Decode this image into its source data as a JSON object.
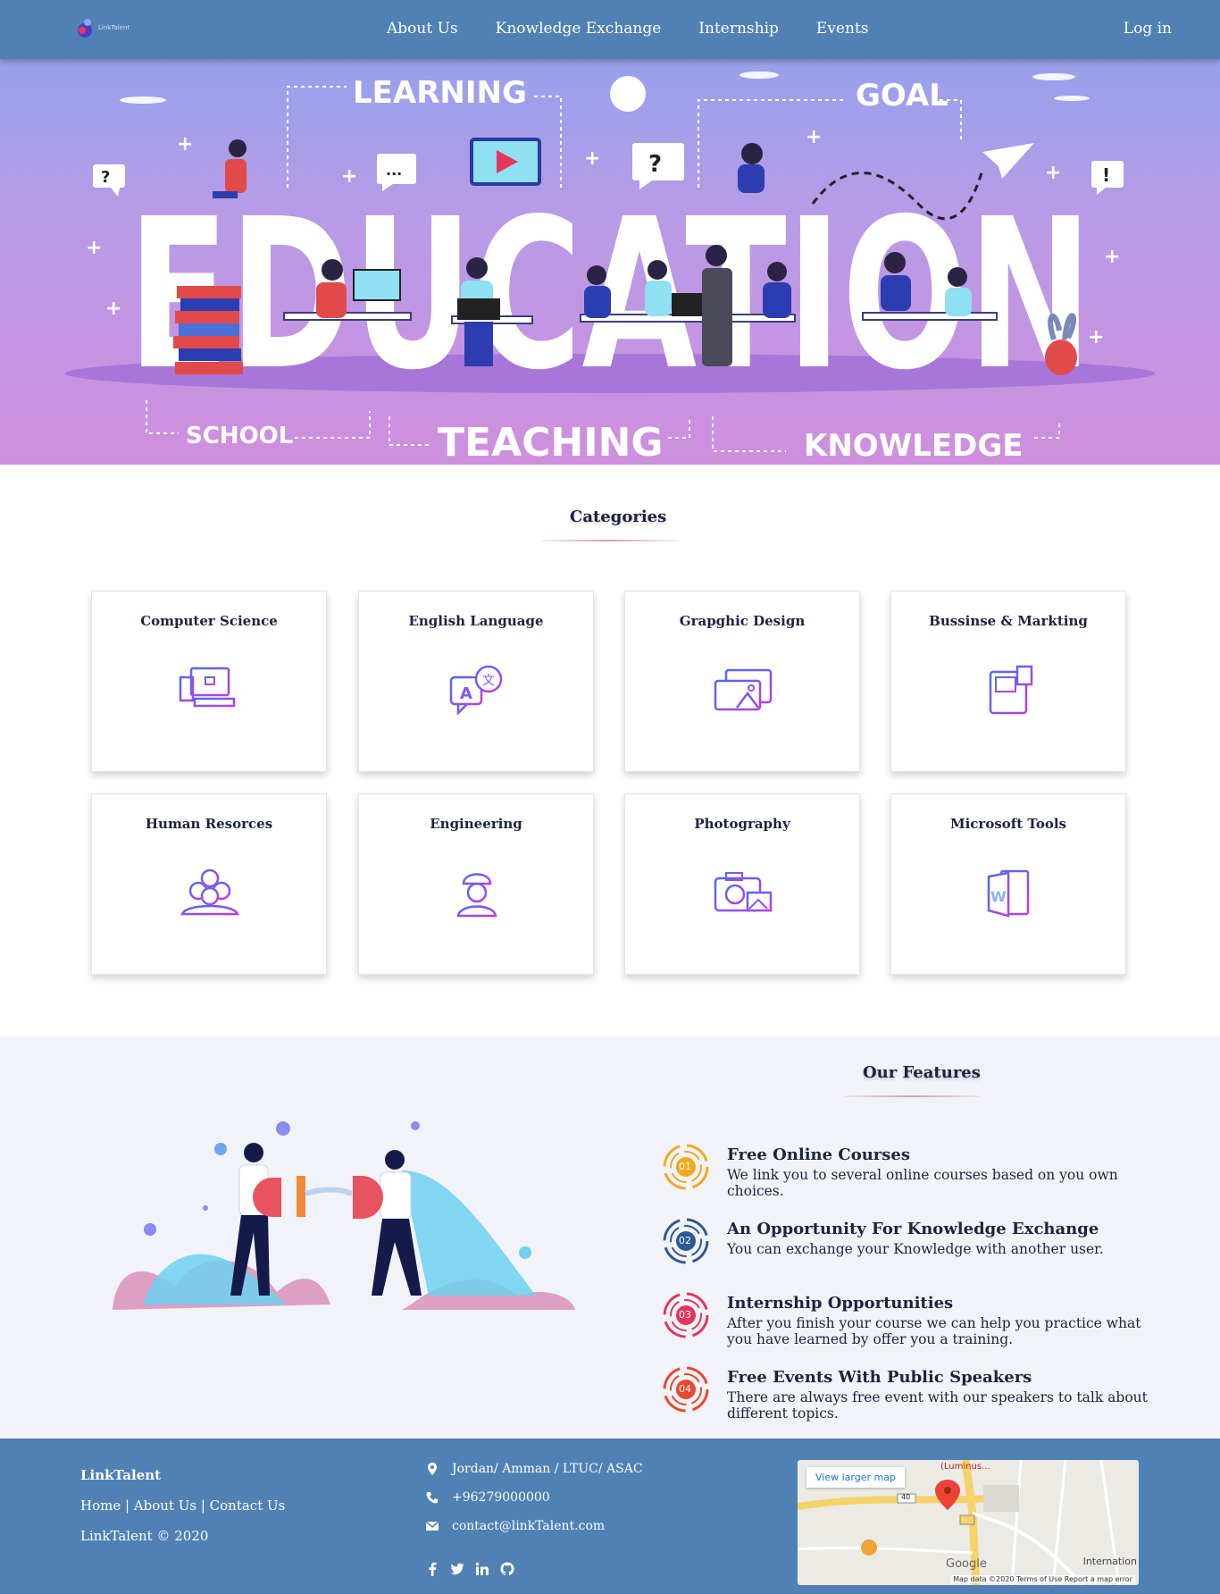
{
  "nav": {
    "logo_text": "LinkTalent",
    "items": [
      "About Us",
      "Knowledge Exchange",
      "Internship",
      "Events"
    ],
    "login": "Log in"
  },
  "hero": {
    "big_word": "EDUCATION",
    "words": {
      "learning": "LEARNING",
      "goal": "GOAL",
      "school": "SCHOOL",
      "teaching": "TEACHING",
      "knowledge": "KNOWLEDGE"
    }
  },
  "categories": {
    "title": "Categories",
    "items": [
      {
        "label": "Computer Science",
        "icon": "computer-icon"
      },
      {
        "label": "English Language",
        "icon": "translate-icon"
      },
      {
        "label": "Grapghic Design",
        "icon": "image-design-icon"
      },
      {
        "label": "Bussinse & Markting",
        "icon": "document-chart-icon"
      },
      {
        "label": "Human Resorces",
        "icon": "people-group-icon"
      },
      {
        "label": "Engineering",
        "icon": "engineer-icon"
      },
      {
        "label": "Photography",
        "icon": "camera-icon"
      },
      {
        "label": "Microsoft Tools",
        "icon": "word-document-icon"
      }
    ]
  },
  "features": {
    "title": "Our Features",
    "items": [
      {
        "num": "01",
        "title": "Free Online Courses",
        "desc": "We link you to several online courses based on you own choices.",
        "color": "#f2a81d"
      },
      {
        "num": "02",
        "title": "An Opportunity For Knowledge Exchange",
        "desc": "You can exchange your Knowledge with another user.",
        "color": "#2d5a94"
      },
      {
        "num": "03",
        "title": "Internship Opportunities",
        "desc": "After you finish your course we can help you practice what you have learned by offer you a training.",
        "color": "#e2365f"
      },
      {
        "num": "04",
        "title": "Free Events With Public Speakers",
        "desc": "There are always free event with our speakers to talk about different topics.",
        "color": "#e8482d"
      }
    ]
  },
  "footer": {
    "brand": "LinkTalent",
    "links": [
      "Home",
      "About Us",
      "Contact Us"
    ],
    "copyright": "LinkTalent © 2020",
    "address": "Jordan/ Amman / LTUC/ ASAC",
    "phone": "+96279000000",
    "email": "contact@linkTalent.com",
    "social_icons": [
      "facebook-icon",
      "twitter-icon",
      "linkedin-icon",
      "github-icon"
    ],
    "map": {
      "larger_link": "View larger map",
      "place": "(Luminus...",
      "google": "Google",
      "international": "Internation",
      "road": "40",
      "attribution": "Map data ©2020   Terms of Use   Report a map error"
    }
  },
  "colors": {
    "nav": "#4f81b5",
    "accent": "#8a4bf0",
    "features_bg": "#f1f3f8"
  }
}
